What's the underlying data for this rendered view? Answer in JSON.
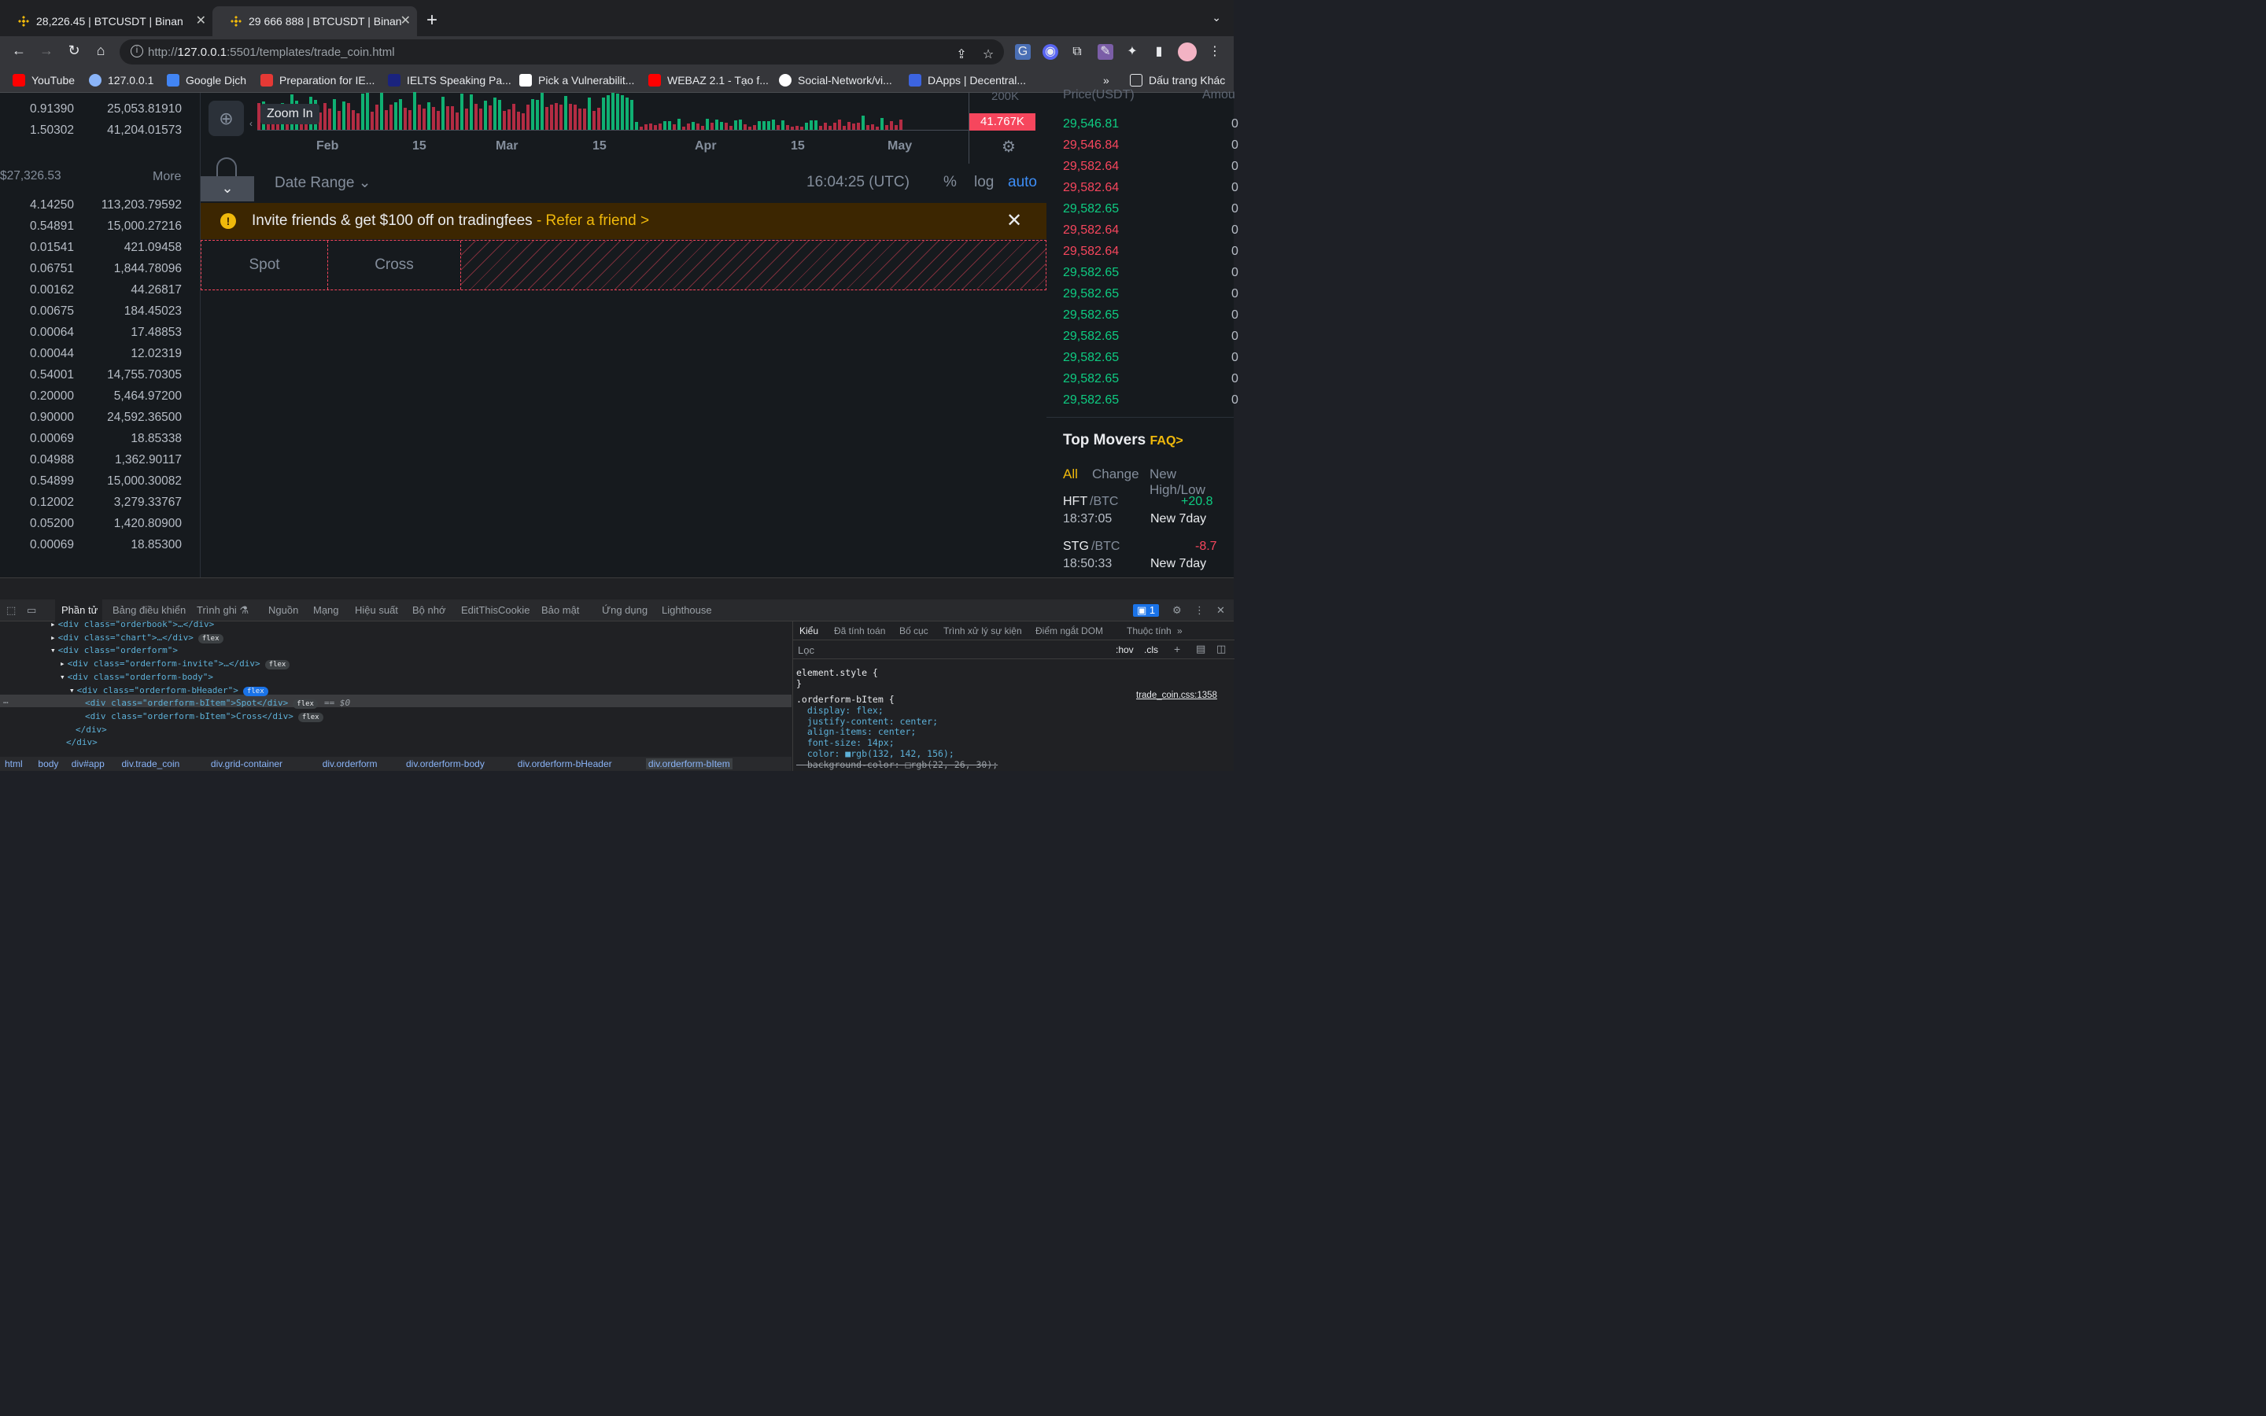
{
  "tabs": [
    {
      "title": "28,226.45 | BTCUSDT | Binan",
      "close": "✕"
    },
    {
      "title": "29 666 888 | BTCUSDT | Binan",
      "close": "✕"
    }
  ],
  "new_tab": "+",
  "address": {
    "scheme": "http://",
    "host": "127.0.0.1",
    "rest": ":5501/templates/trade_coin.html"
  },
  "bookmarks": [
    {
      "label": "YouTube",
      "color": "#ff0000"
    },
    {
      "label": "127.0.0.1",
      "color": "#8ab4f8"
    },
    {
      "label": "Google Dịch",
      "color": "#4285f4"
    },
    {
      "label": "Preparation for IE...",
      "color": "#e53935"
    },
    {
      "label": "IELTS Speaking Pa...",
      "color": "#1a237e"
    },
    {
      "label": "Pick a Vulnerabilit...",
      "color": "#ffffff"
    },
    {
      "label": "WEBAZ 2.1 - Tạo f...",
      "color": "#ff0000"
    },
    {
      "label": "Social-Network/vi...",
      "color": "#ffffff"
    },
    {
      "label": "DApps | Decentral...",
      "color": "#3c64e0"
    }
  ],
  "bookmarks_more": "»",
  "bookmarks_other": "Dấu trang Khác",
  "left": {
    "top_rows": [
      [
        "0.91390",
        "25,053.81910"
      ],
      [
        "1.50302",
        "41,204.01573"
      ]
    ],
    "price": "$27,326.53",
    "more": "More",
    "rows": [
      [
        "4.14250",
        "113,203.79592"
      ],
      [
        "0.54891",
        "15,000.27216"
      ],
      [
        "0.01541",
        "421.09458"
      ],
      [
        "0.06751",
        "1,844.78096"
      ],
      [
        "0.00162",
        "44.26817"
      ],
      [
        "0.00675",
        "184.45023"
      ],
      [
        "0.00064",
        "17.48853"
      ],
      [
        "0.00044",
        "12.02319"
      ],
      [
        "0.54001",
        "14,755.70305"
      ],
      [
        "0.20000",
        "5,464.97200"
      ],
      [
        "0.90000",
        "24,592.36500"
      ],
      [
        "0.00069",
        "18.85338"
      ],
      [
        "0.04988",
        "1,362.90117"
      ],
      [
        "0.54899",
        "15,000.30082"
      ],
      [
        "0.12002",
        "3,279.33767"
      ],
      [
        "0.05200",
        "1,420.80900"
      ],
      [
        "0.00069",
        "18.85300"
      ]
    ]
  },
  "chart": {
    "zoom_tip": "Zoom In",
    "volume_label": "200K",
    "last_volume": "41.767K",
    "x_ticks": [
      "Feb",
      "15",
      "Mar",
      "15",
      "Apr",
      "15",
      "May"
    ],
    "date_range": "Date Range ⌄",
    "time": "16:04:25 (UTC)",
    "pct": "%",
    "log": "log",
    "auto": "auto"
  },
  "invite": {
    "text": "Invite friends & get $100 off on tradingfees",
    "link": " - Refer a friend >",
    "close": "✕"
  },
  "orderform": {
    "items": [
      "Spot",
      "Cross"
    ]
  },
  "orderbook": {
    "header_price": "Price(USDT)",
    "header_amount": "Amou",
    "rows": [
      {
        "price": "29,546.81",
        "side": "green",
        "amt": "0"
      },
      {
        "price": "29,546.84",
        "side": "red",
        "amt": "0"
      },
      {
        "price": "29,582.64",
        "side": "red",
        "amt": "0"
      },
      {
        "price": "29,582.64",
        "side": "red",
        "amt": "0"
      },
      {
        "price": "29,582.65",
        "side": "green",
        "amt": "0"
      },
      {
        "price": "29,582.64",
        "side": "red",
        "amt": "0"
      },
      {
        "price": "29,582.64",
        "side": "red",
        "amt": "0"
      },
      {
        "price": "29,582.65",
        "side": "green",
        "amt": "0"
      },
      {
        "price": "29,582.65",
        "side": "green",
        "amt": "0"
      },
      {
        "price": "29,582.65",
        "side": "green",
        "amt": "0"
      },
      {
        "price": "29,582.65",
        "side": "green",
        "amt": "0"
      },
      {
        "price": "29,582.65",
        "side": "green",
        "amt": "0"
      },
      {
        "price": "29,582.65",
        "side": "green",
        "amt": "0"
      },
      {
        "price": "29,582.65",
        "side": "green",
        "amt": "0"
      }
    ]
  },
  "movers": {
    "title": "Top Movers",
    "faq": "FAQ>",
    "tabs": [
      "All",
      "Change",
      "New High/Low"
    ],
    "rows": [
      {
        "coin": "HFT",
        "pair": "/BTC",
        "time": "18:37:05",
        "change": "+20.8",
        "note": "New 7day",
        "side": "green"
      },
      {
        "coin": "STG",
        "pair": "/BTC",
        "time": "18:50:33",
        "change": "-8.7",
        "note": "New 7day",
        "side": "red"
      }
    ]
  },
  "devtools": {
    "tabs": [
      "Phần tử",
      "Bảng điều khiển",
      "Trình ghi ⚗",
      "Nguồn",
      "Mạng",
      "Hiệu suất",
      "Bộ nhớ",
      "EditThisCookie",
      "Bảo mật",
      "Ứng dụng",
      "Lighthouse"
    ],
    "issues": "1",
    "lines": [
      "<div class=\"orderbook\">…</div>",
      "<div class=\"chart\">…</div>",
      "<div class=\"orderform\">",
      "<div class=\"orderform-invite\">…</div>",
      "<div class=\"orderform-body\">",
      "<div class=\"orderform-bHeader\">",
      "<div class=\"orderform-bItem\">Spot</div>",
      "<div class=\"orderform-bItem\">Cross</div>",
      "</div>",
      "</div>"
    ],
    "flex": "flex",
    "eq": "== $0",
    "breadcrumbs": [
      "html",
      "body",
      "div#app",
      "div.trade_coin",
      "div.grid-container",
      "div.orderform",
      "div.orderform-body",
      "div.orderform-bHeader",
      "div.orderform-bItem"
    ],
    "style_tabs": [
      "Kiểu",
      "Đã tính toán",
      "Bố cục",
      "Trình xử lý sự kiện",
      "Điểm ngắt DOM",
      "Thuộc tính",
      "»"
    ],
    "filter": "Lọc",
    "hov": ":hov",
    "cls": ".cls",
    "css": [
      "element.style {",
      "}",
      ".orderform-bItem {",
      "  display: flex;",
      "  justify-content: center;",
      "  align-items: center;",
      "  font-size: 14px;",
      "  color: ■rgb(132, 142, 156);",
      "  background-color: □rgb(22, 26, 30);"
    ],
    "css_source": "trade_coin.css:1358"
  }
}
